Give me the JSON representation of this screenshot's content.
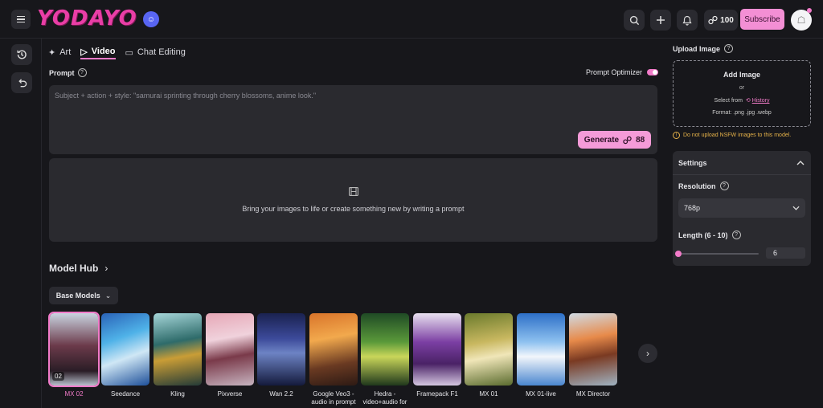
{
  "brand": {
    "logo": "YODAYO",
    "accent": "#f27bc9"
  },
  "header": {
    "credits": "100",
    "subscribe_label": "Subscribe"
  },
  "tabs": [
    {
      "label": "Art",
      "icon": "sparkles-icon"
    },
    {
      "label": "Video",
      "icon": "video-icon",
      "active": true
    },
    {
      "label": "Chat Editing",
      "icon": "chat-image-icon"
    }
  ],
  "prompt": {
    "label": "Prompt",
    "placeholder": "Subject + action + style: \"samurai sprinting through cherry blossoms, anime look.\"",
    "optimizer_label": "Prompt Optimizer",
    "optimizer_on": true,
    "generate_label": "Generate",
    "generate_cost": "88"
  },
  "empty_state": {
    "text": "Bring your images to life or create something new by writing a prompt"
  },
  "model_hub": {
    "title": "Model Hub",
    "filter_label": "Base Models",
    "models": [
      {
        "name": "MX 02",
        "badge": "02",
        "selected": true
      },
      {
        "name": "Seedance"
      },
      {
        "name": "Kling"
      },
      {
        "name": "Pixverse"
      },
      {
        "name": "Wan 2.2"
      },
      {
        "name": "Google Veo3 - audio in prompt"
      },
      {
        "name": "Hedra - video+audio for"
      },
      {
        "name": "Framepack F1"
      },
      {
        "name": "MX 01"
      },
      {
        "name": "MX 01-live"
      },
      {
        "name": "MX Director"
      }
    ]
  },
  "upload": {
    "title": "Upload Image",
    "add_label": "Add Image",
    "or_label": "or",
    "select_from": "Select from",
    "history_link": "History",
    "format": "Format: .png .jpg .webp",
    "nsfw_warning": "Do not upload NSFW images to this model."
  },
  "settings": {
    "title": "Settings",
    "resolution_label": "Resolution",
    "resolution_value": "768p",
    "length_label": "Length (6 - 10)",
    "length_value": "6",
    "length_min": 6,
    "length_max": 10
  }
}
